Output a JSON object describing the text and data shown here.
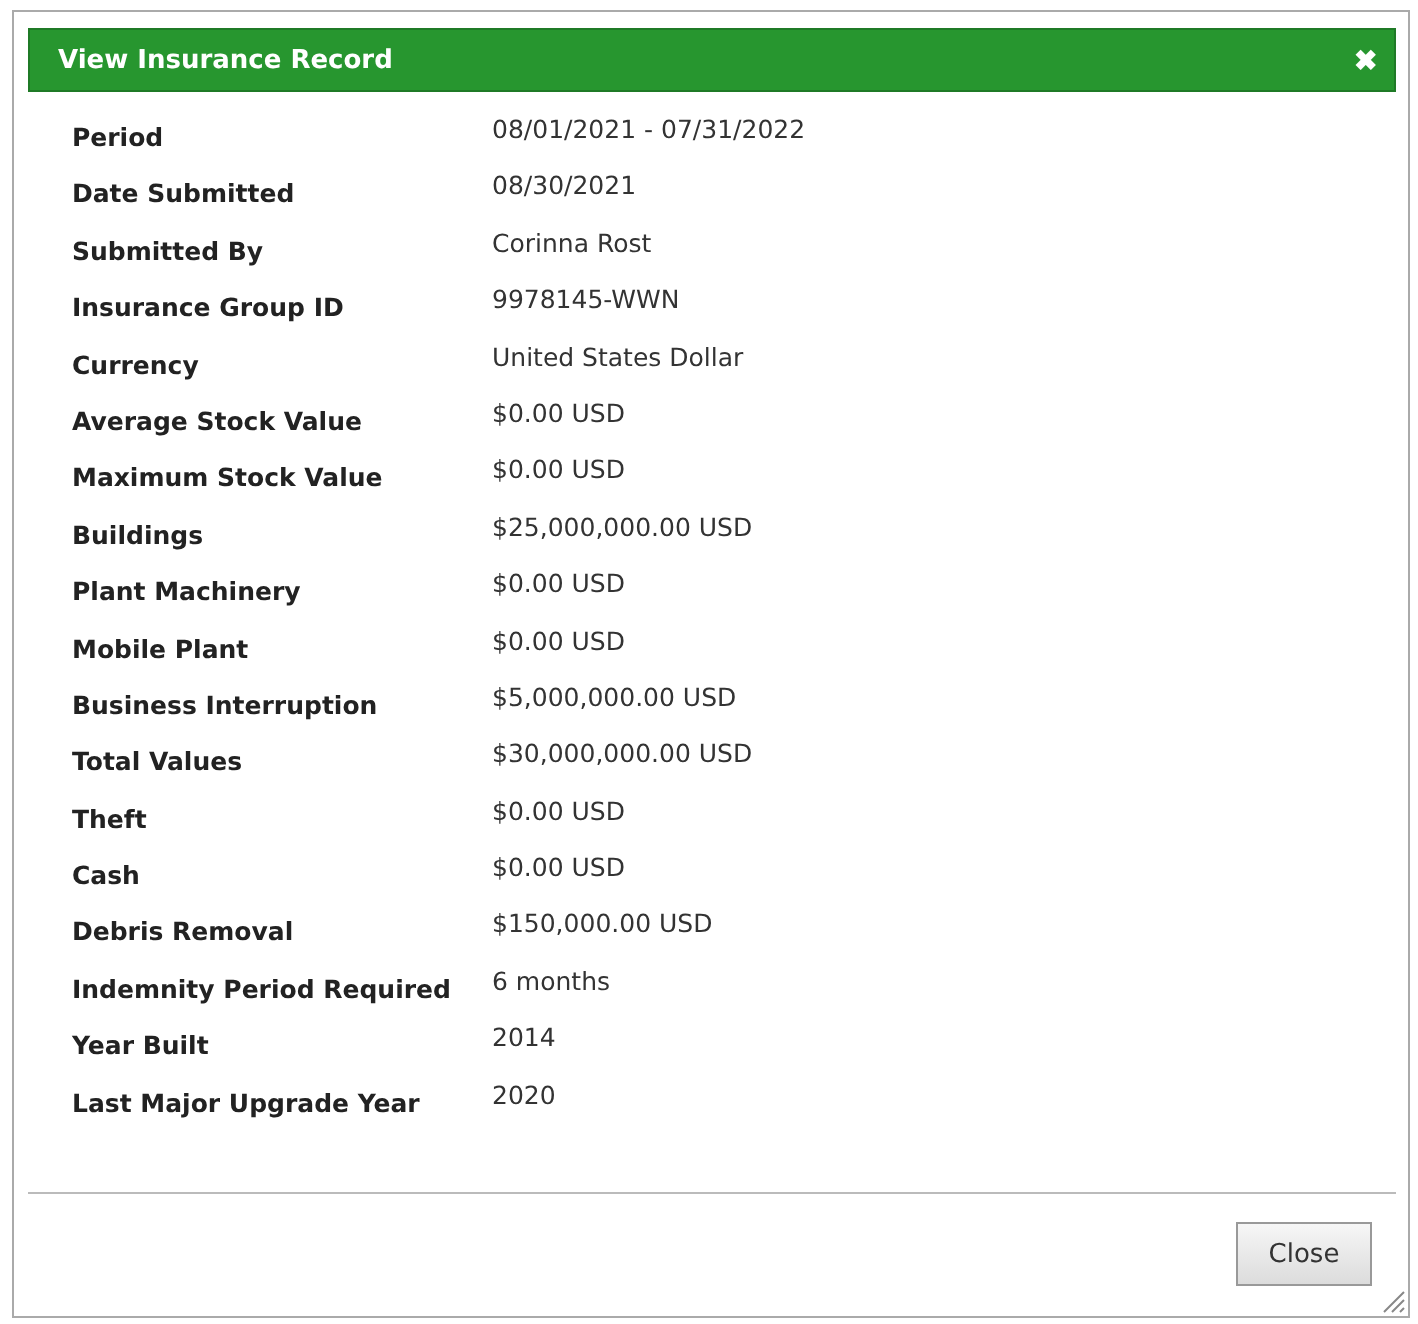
{
  "dialog": {
    "title": "View Insurance Record",
    "close_icon": "✖"
  },
  "fields": [
    {
      "label": "Period",
      "value": "08/01/2021 - 07/31/2022"
    },
    {
      "label": "Date Submitted",
      "value": "08/30/2021"
    },
    {
      "label": "Submitted By",
      "value": "Corinna Rost"
    },
    {
      "label": "Insurance Group ID",
      "value": "9978145-WWN"
    },
    {
      "label": "Currency",
      "value": "United States Dollar"
    },
    {
      "label": "Average Stock Value",
      "value": "$0.00 USD"
    },
    {
      "label": "Maximum Stock Value",
      "value": "$0.00 USD"
    },
    {
      "label": "Buildings",
      "value": "$25,000,000.00 USD"
    },
    {
      "label": "Plant Machinery",
      "value": "$0.00 USD"
    },
    {
      "label": "Mobile Plant",
      "value": "$0.00 USD"
    },
    {
      "label": "Business Interruption",
      "value": "$5,000,000.00 USD"
    },
    {
      "label": "Total Values",
      "value": "$30,000,000.00 USD"
    },
    {
      "label": "Theft",
      "value": "$0.00 USD"
    },
    {
      "label": "Cash",
      "value": "$0.00 USD"
    },
    {
      "label": "Debris Removal",
      "value": "$150,000.00 USD"
    },
    {
      "label": "Indemnity Period Required",
      "value": "6 months"
    },
    {
      "label": "Year Built",
      "value": "2014"
    },
    {
      "label": "Last Major Upgrade Year",
      "value": "2020"
    }
  ],
  "buttons": [
    "Close"
  ]
}
